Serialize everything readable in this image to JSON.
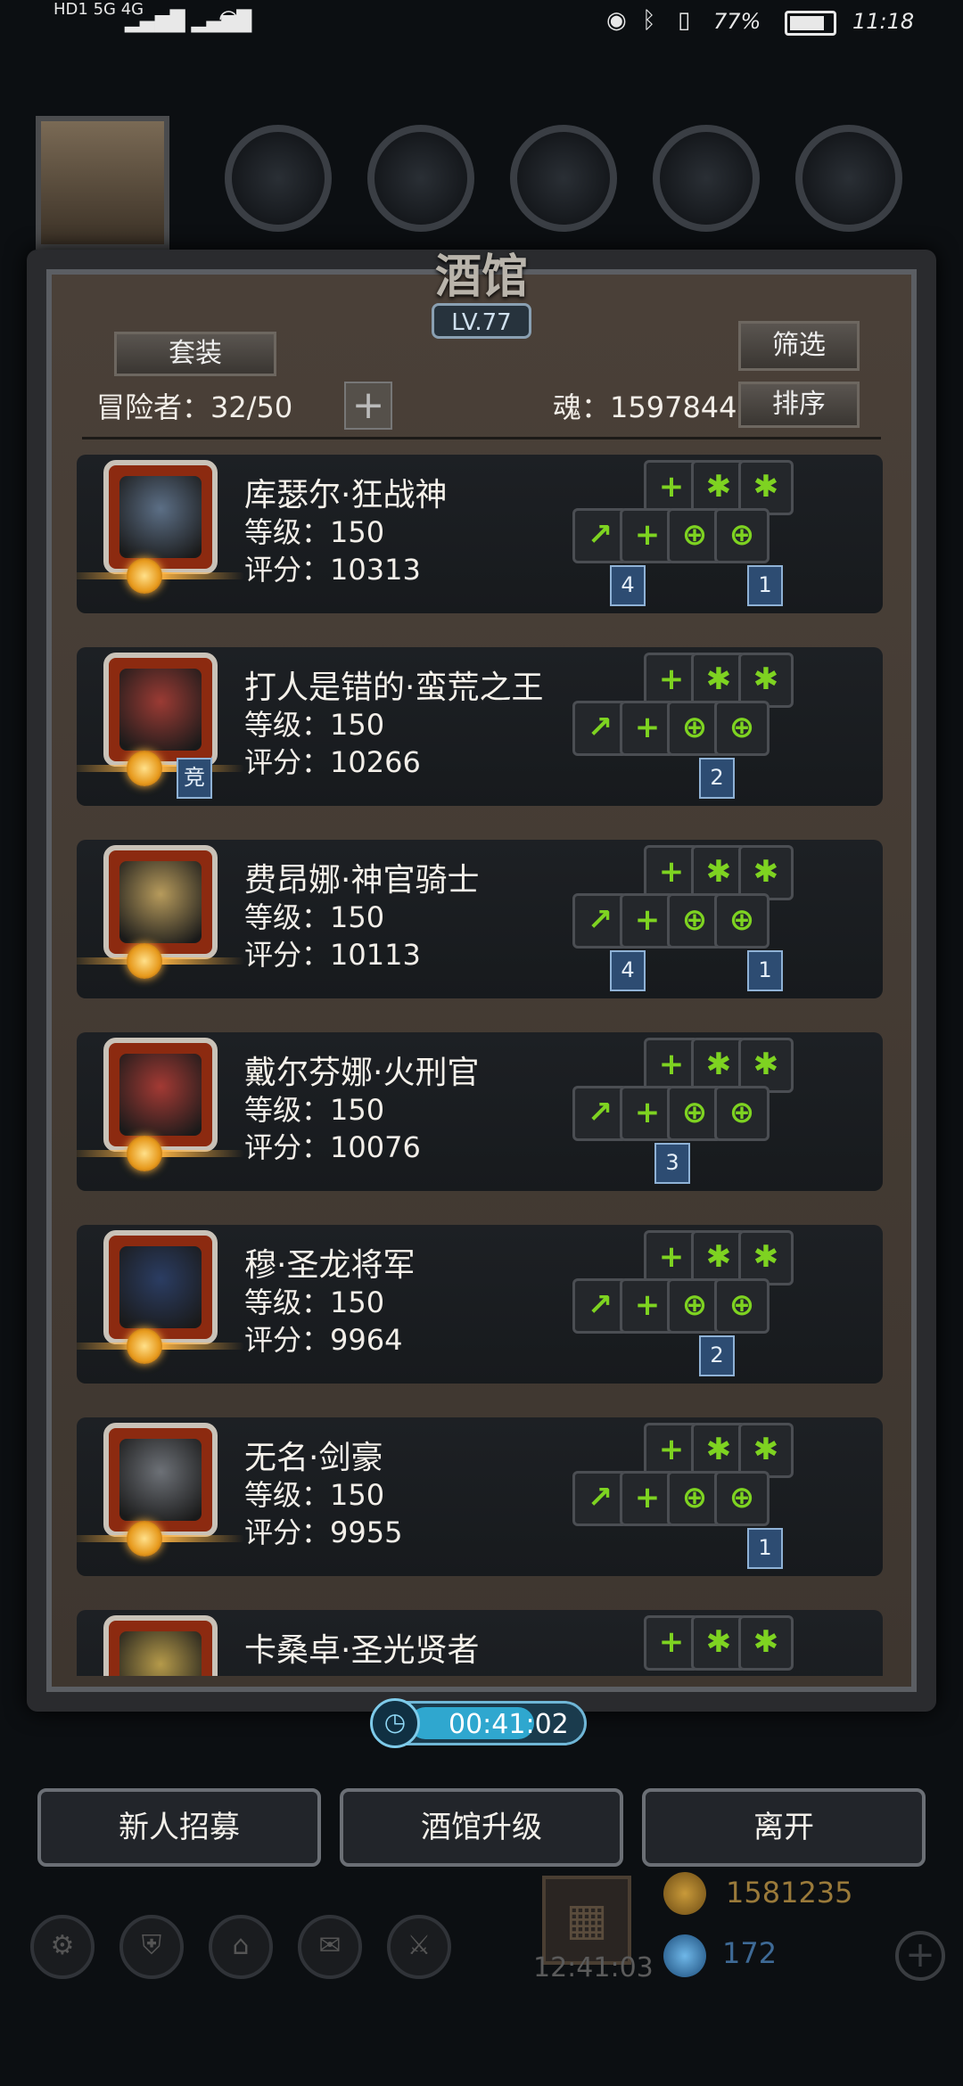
{
  "status_bar": {
    "left": "HD1 5G 4G",
    "right": "77%",
    "time": "11:18"
  },
  "panel": {
    "title": "酒馆",
    "level": "LV.77",
    "set_label": "套装",
    "filter_label": "筛选",
    "sort_label": "排序",
    "adventurers": "冒险者：32/50",
    "soul": "魂：1597844"
  },
  "heroes": [
    {
      "name": "库瑟尔·狂战神",
      "level": "等级：150",
      "score": "评分：10313",
      "face": "#5c6f86",
      "tags": [
        {
          "text": "4",
          "col": "left"
        },
        {
          "text": "1",
          "col": "right"
        }
      ]
    },
    {
      "name": "打人是错的·蛮荒之王",
      "level": "等级：150",
      "score": "评分：10266",
      "face": "#9b3b34",
      "tags": [
        {
          "text": "竞",
          "col": "hero"
        },
        {
          "text": "2",
          "col": "mid"
        }
      ]
    },
    {
      "name": "费昂娜·神官骑士",
      "level": "等级：150",
      "score": "评分：10113",
      "face": "#b79b5c",
      "tags": [
        {
          "text": "4",
          "col": "left"
        },
        {
          "text": "1",
          "col": "right"
        }
      ]
    },
    {
      "name": "戴尔芬娜·火刑官",
      "level": "等级：150",
      "score": "评分：10076",
      "face": "#a33a34",
      "tags": [
        {
          "text": "3",
          "col": "lmid"
        }
      ]
    },
    {
      "name": "穆·圣龙将军",
      "level": "等级：150",
      "score": "评分：9964",
      "face": "#2b3d63",
      "tags": [
        {
          "text": "2",
          "col": "mid"
        }
      ]
    },
    {
      "name": "无名·剑豪",
      "level": "等级：150",
      "score": "评分：9955",
      "face": "#6d7177",
      "tags": [
        {
          "text": "1",
          "col": "right"
        }
      ]
    },
    {
      "name": "卡桑卓·圣光贤者",
      "level": "",
      "score": "",
      "face": "#b59a4a",
      "tags": []
    }
  ],
  "timer": "00:41:02",
  "buttons": {
    "recruit": "新人招募",
    "upgrade": "酒馆升级",
    "leave": "离开"
  },
  "bottom_bar": {
    "gold": "1581235",
    "gems": "172",
    "clock": "12:41:03"
  },
  "colors": {
    "accent_green": "#7ed321",
    "tag_blue": "#2d4c72",
    "timer_blue": "#2fa7cf"
  }
}
